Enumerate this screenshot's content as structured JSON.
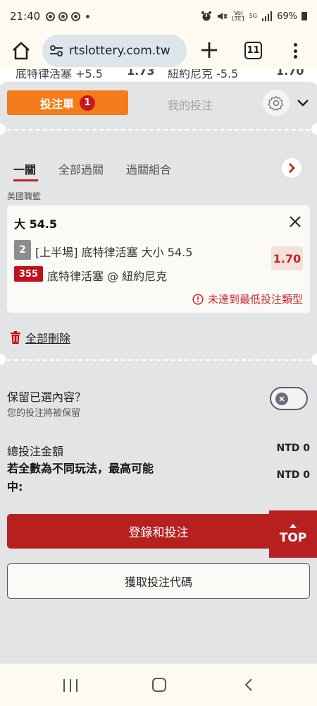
{
  "status_bar": {
    "time": "21:40",
    "network_top": "Vo)",
    "network_bottom": "LTE1",
    "gen": "5G",
    "battery": "69%"
  },
  "browser": {
    "url": "rtslottery.com.tw",
    "tab_count": "11"
  },
  "behind_row": {
    "team_home": "底特律活塞 +5.5",
    "odds_home": "1.73",
    "team_away": "紐約尼克 -5.5",
    "odds_away": "1.70"
  },
  "slip": {
    "tab_betslip": "投注單",
    "betslip_count": "1",
    "tab_mybets": "我的投注",
    "subtabs": [
      "一關",
      "全部過關",
      "過關組合"
    ],
    "league": "美國職籃",
    "bet": {
      "selection": "大 54.5",
      "tag": "2",
      "market": "[上半場] 底特律活塞 大小 54.5",
      "odds": "1.70",
      "game_number": "355",
      "match": "底特律活塞 @ 紐約尼克",
      "warning": "未達到最低投注類型"
    },
    "delete_all": "全部刪除",
    "keep_selection_label": "保留已選內容？",
    "keep_selection_sub": "您的投注將被保留",
    "total_stake_label": "總投注金額",
    "total_stake_value": "NTD 0",
    "max_win_label": "若全數為不同玩法，最高可能中:",
    "max_win_value": "NTD 0",
    "login_button": "登錄和投注",
    "get_code_button": "獲取投注代碼",
    "top_button": "TOP"
  },
  "colors": {
    "orange": "#f47c1a",
    "red": "#b62120",
    "badge_red": "#c0121a",
    "odds_bg": "#f3e1dc"
  }
}
